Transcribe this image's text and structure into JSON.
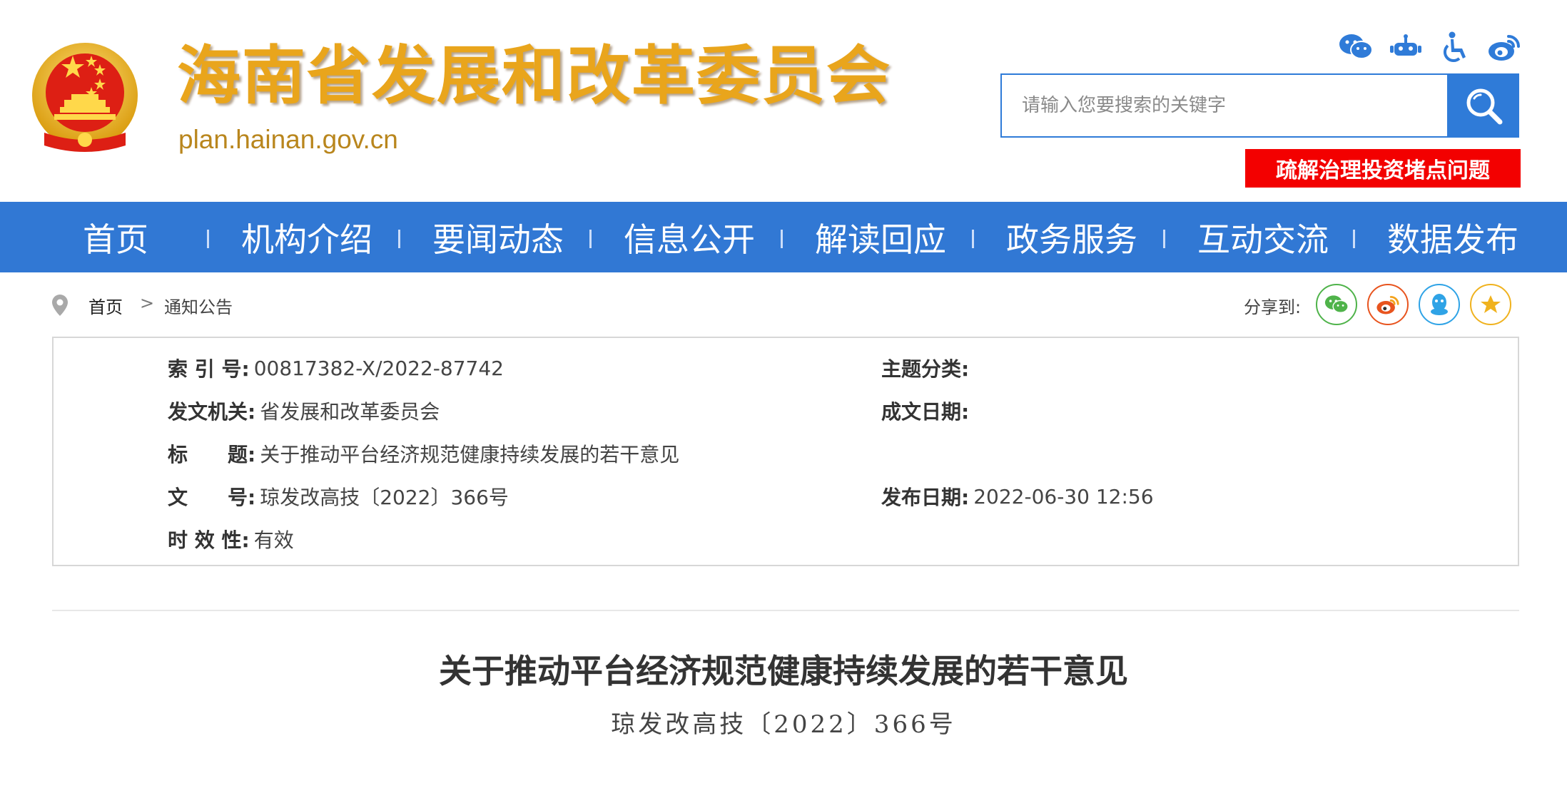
{
  "header": {
    "site_title": "海南省发展和改革委员会",
    "domain": "plan.hainan.gov.cn",
    "icons": [
      "wechat-icon",
      "robot-icon",
      "accessibility-icon",
      "weibo-icon"
    ],
    "search": {
      "placeholder": "请输入您要搜索的关键字",
      "value": ""
    },
    "promo_banner": "疏解治理投资堵点问题"
  },
  "nav": {
    "items": [
      "首页",
      "机构介绍",
      "要闻动态",
      "信息公开",
      "解读回应",
      "政务服务",
      "互动交流",
      "数据发布"
    ]
  },
  "breadcrumb": {
    "home": "首页",
    "separator": ">",
    "current": "通知公告"
  },
  "share": {
    "label": "分享到:",
    "targets": [
      "wechat-share-icon",
      "weibo-share-icon",
      "qq-share-icon",
      "favorite-share-icon"
    ]
  },
  "meta": {
    "index_label": "索 引 号:",
    "index_value": "00817382-X/2022-87742",
    "topic_label": "主题分类:",
    "topic_value": "",
    "issuer_label": "发文机关:",
    "issuer_value": "省发展和改革委员会",
    "created_label": "成文日期:",
    "created_value": "",
    "title_label": "标　　题:",
    "title_value": "关于推动平台经济规范健康持续发展的若干意见",
    "docno_label": "文　　号:",
    "docno_value": "琼发改高技〔2022〕366号",
    "published_label": "发布日期:",
    "published_value": "2022-06-30 12:56",
    "validity_label": "时 效 性:",
    "validity_value": "有效"
  },
  "article": {
    "title": "关于推动平台经济规范健康持续发展的若干意见",
    "doc_number": "琼发改高技〔2022〕366号"
  },
  "colors": {
    "brand_blue": "#3178d4",
    "title_gold": "#e9a51c",
    "banner_red": "#f30000"
  }
}
